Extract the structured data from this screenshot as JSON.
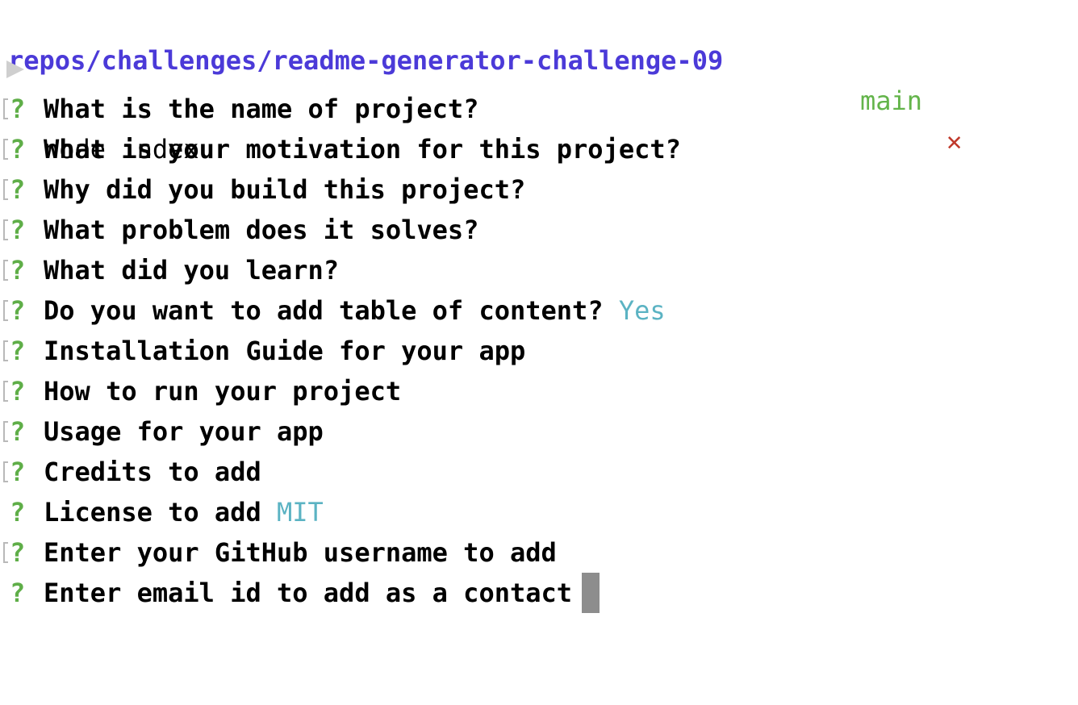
{
  "header": {
    "path": "repos/challenges/readme-generator-challenge-09",
    "branch": "main",
    "dirty_marker": "✕"
  },
  "command": {
    "text": "node index"
  },
  "prompts": [
    {
      "marker": "?",
      "question": "What is the name of project?",
      "answer": "",
      "bracket": true
    },
    {
      "marker": "?",
      "question": "What is your motivation for this project?",
      "answer": "",
      "bracket": true
    },
    {
      "marker": "?",
      "question": "Why did you build this project?",
      "answer": "",
      "bracket": true
    },
    {
      "marker": "?",
      "question": "What problem does it solves?",
      "answer": "",
      "bracket": true
    },
    {
      "marker": "?",
      "question": "What did you learn?",
      "answer": "",
      "bracket": true
    },
    {
      "marker": "?",
      "question": "Do you want to add table of content?",
      "answer": "Yes",
      "bracket": true
    },
    {
      "marker": "?",
      "question": "Installation Guide for your app",
      "answer": "",
      "bracket": true
    },
    {
      "marker": "?",
      "question": "How to run your project",
      "answer": "",
      "bracket": true
    },
    {
      "marker": "?",
      "question": "Usage for your app",
      "answer": "",
      "bracket": true
    },
    {
      "marker": "?",
      "question": "Credits to add",
      "answer": "",
      "bracket": true
    },
    {
      "marker": "?",
      "question": "License to add",
      "answer": "MIT",
      "bracket": false
    },
    {
      "marker": "?",
      "question": "Enter your GitHub username to add",
      "answer": "",
      "bracket": true
    },
    {
      "marker": "?",
      "question": "Enter email id to add as a contact",
      "answer": "",
      "bracket": false,
      "active": true
    }
  ],
  "colors": {
    "path": "#4b3ad8",
    "branch": "#63b44a",
    "dirty": "#c0392b",
    "question_mark": "#5fae48",
    "answer": "#5bb3c3",
    "cursor": "#8d8d8d"
  }
}
